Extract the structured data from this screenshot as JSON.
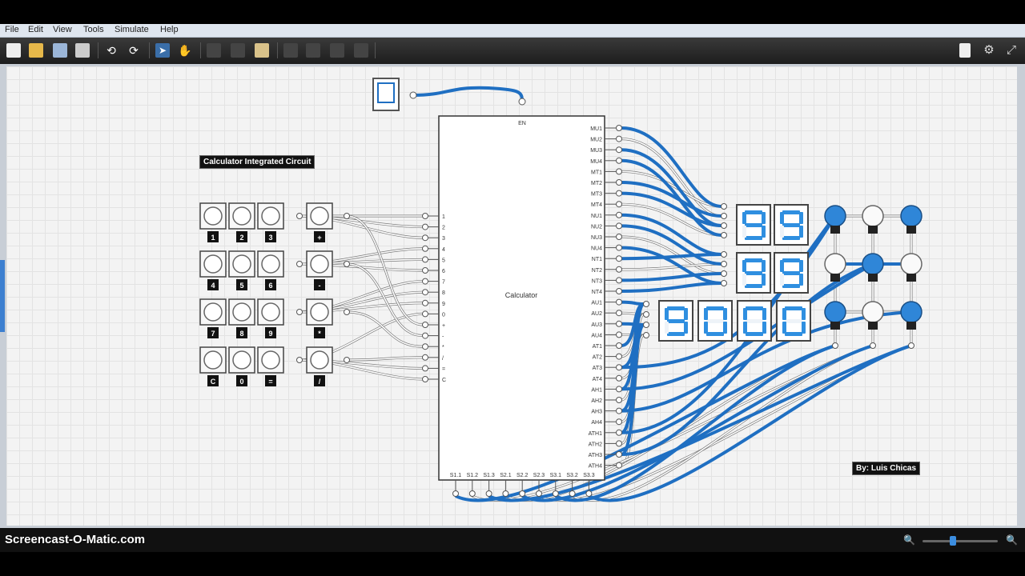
{
  "menu": [
    "File",
    "Edit",
    "View",
    "Tools",
    "Simulate",
    "Help"
  ],
  "toolbar": {
    "buttons": [
      "new-icon",
      "open-icon",
      "save-icon",
      "print-icon",
      "undo-icon",
      "redo-icon",
      "select-icon",
      "pan-icon",
      "cut-icon",
      "copy-icon",
      "paste-icon",
      "rotate-icon",
      "flip-icon",
      "align-icon",
      "group-icon"
    ],
    "right_buttons": [
      "page-icon",
      "settings-icon",
      "fullscreen-icon"
    ]
  },
  "circuit": {
    "title_label": "Calculator Integrated Circuit",
    "author_label": "By: Luis Chicas",
    "chip_name": "Calculator",
    "enable_pin": "EN",
    "left_pins": [
      "1",
      "2",
      "3",
      "4",
      "5",
      "6",
      "7",
      "8",
      "9",
      "0",
      "+",
      "-",
      "*",
      "/",
      "=",
      "C"
    ],
    "right_pins": [
      "MU1",
      "MU2",
      "MU3",
      "MU4",
      "MT1",
      "MT2",
      "MT3",
      "MT4",
      "NU1",
      "NU2",
      "NU3",
      "NU4",
      "NT1",
      "NT2",
      "NT3",
      "NT4",
      "AU1",
      "AU2",
      "AU3",
      "AU4",
      "AT1",
      "AT2",
      "AT3",
      "AT4",
      "AH1",
      "AH2",
      "AH3",
      "AH4",
      "ATH1",
      "ATH2",
      "ATH3",
      "ATH4"
    ],
    "bottom_pins": [
      "S1.1",
      "S1.2",
      "S1.3",
      "S2.1",
      "S2.2",
      "S2.3",
      "S3.1",
      "S3.2",
      "S3.3"
    ],
    "keypad_rows": [
      [
        "1",
        "2",
        "3",
        "+"
      ],
      [
        "4",
        "5",
        "6",
        "-"
      ],
      [
        "7",
        "8",
        "9",
        "*"
      ],
      [
        "C",
        "0",
        "=",
        "/"
      ]
    ],
    "display_row1": [
      "9",
      "9"
    ],
    "display_row2": [
      "9",
      "9"
    ],
    "display_row3": [
      "9",
      "0",
      "0",
      "0"
    ],
    "bulb_states": [
      [
        true,
        false,
        true
      ],
      [
        false,
        true,
        false
      ],
      [
        true,
        false,
        true
      ]
    ],
    "wire_on_color": "#1f6fc2",
    "wire_off_color": "#ffffff",
    "segment_color": "#2f8fe0"
  },
  "status": {
    "watermark": "Screencast-O-Matic.com",
    "zoom_out_icon": "zoom-out-icon",
    "zoom_in_icon": "zoom-in-icon"
  }
}
